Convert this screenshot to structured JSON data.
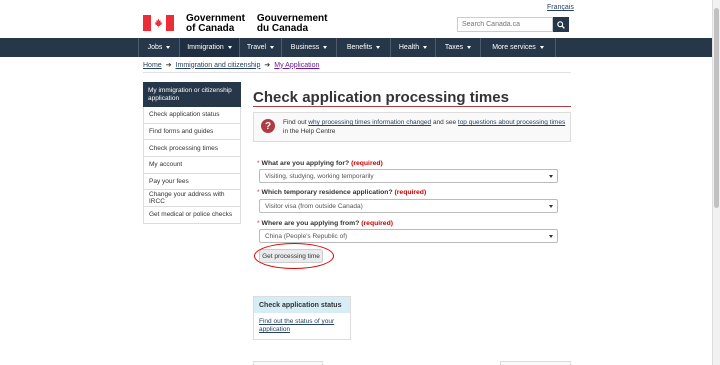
{
  "header": {
    "language_link": "Français",
    "wordmark_en_1": "Government",
    "wordmark_en_2": "of Canada",
    "wordmark_fr_1": "Gouvernement",
    "wordmark_fr_2": "du Canada",
    "search_placeholder": "Search Canada.ca"
  },
  "nav": [
    {
      "label": "Jobs"
    },
    {
      "label": "Immigration"
    },
    {
      "label": "Travel"
    },
    {
      "label": "Business"
    },
    {
      "label": "Benefits"
    },
    {
      "label": "Health"
    },
    {
      "label": "Taxes"
    },
    {
      "label": "More services"
    }
  ],
  "breadcrumb": {
    "home": "Home",
    "immigration": "Immigration and citizenship",
    "current": "My Application"
  },
  "sidebar": {
    "heading": "My immigration or citizenship application",
    "items": [
      {
        "label": "Check application status"
      },
      {
        "label": "Find forms and guides"
      },
      {
        "label": "Check processing times"
      },
      {
        "label": "My account"
      },
      {
        "label": "Pay your fees"
      },
      {
        "label": "Change your address with IRCC"
      },
      {
        "label": "Get medical or police checks"
      }
    ]
  },
  "main": {
    "title": "Check application processing times",
    "help": {
      "prefix": "Find out ",
      "link1": "why processing times information changed",
      "middle": " and see ",
      "link2": "top questions about processing times",
      "suffix": " in the Help Centre"
    },
    "q1": {
      "label": "What are you applying for?",
      "required": "(required)",
      "value": "Visiting, studying, working temporarily"
    },
    "q2": {
      "label": "Which temporary residence application?",
      "required": "(required)",
      "value": "Visitor visa (from outside Canada)"
    },
    "q3": {
      "label": "Where are you applying from?",
      "required": "(required)",
      "value": "China (People's Republic of)"
    },
    "button": "Get processing time",
    "card": {
      "title": "Check application status",
      "link": "Find out the status of your application"
    }
  },
  "colors": {
    "nav_bg": "#26374a",
    "accent_red": "#af3c43",
    "flag_red": "#eb2d37",
    "card_head": "#d7edf5"
  }
}
